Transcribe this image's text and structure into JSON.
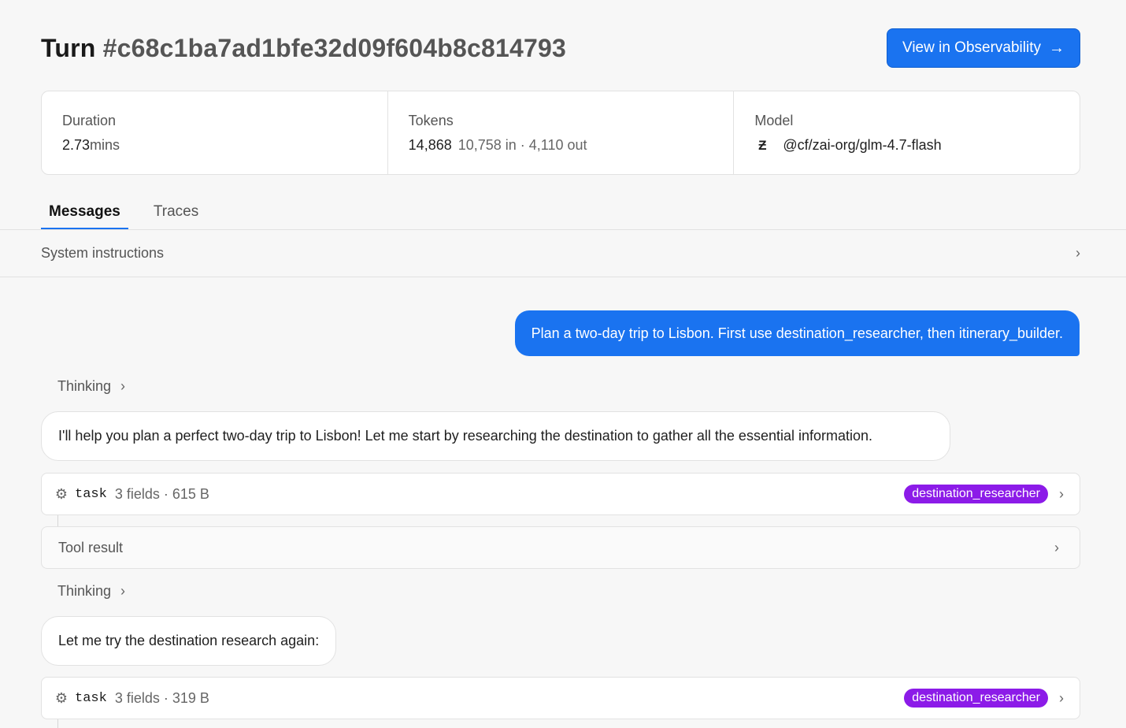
{
  "header": {
    "turn_label": "Turn",
    "turn_id": "#c68c1ba7ad1bfe32d09f604b8c814793",
    "observability_button": "View in Observability",
    "arrow_icon": "arrow-right-icon"
  },
  "stats": {
    "duration": {
      "label": "Duration",
      "value": "2.73",
      "unit": "mins"
    },
    "tokens": {
      "label": "Tokens",
      "total": "14,868",
      "detail": "10,758 in · 4,110 out"
    },
    "model": {
      "label": "Model",
      "icon": "z",
      "value": "@cf/zai-org/glm-4.7-flash"
    }
  },
  "tabs": [
    {
      "label": "Messages",
      "active": true
    },
    {
      "label": "Traces",
      "active": false
    }
  ],
  "system_instructions": {
    "label": "System instructions"
  },
  "messages": {
    "user": "Plan a two-day trip to Lisbon. First use destination_researcher, then itinerary_builder.",
    "thinking_label": "Thinking",
    "assistant_1": "I'll help you plan a perfect two-day trip to Lisbon! Let me start by researching the destination to gather all the essential information.",
    "tool_call_1": {
      "name": "task",
      "meta": "3 fields · 615 B",
      "badge": "destination_researcher"
    },
    "tool_result_label": "Tool result",
    "assistant_2": "Let me try the destination research again:",
    "tool_call_2": {
      "name": "task",
      "meta": "3 fields · 319 B",
      "badge": "destination_researcher"
    }
  },
  "colors": {
    "accent": "#1a73f0",
    "badge": "#8c1be8",
    "background": "#f7f7f7"
  }
}
